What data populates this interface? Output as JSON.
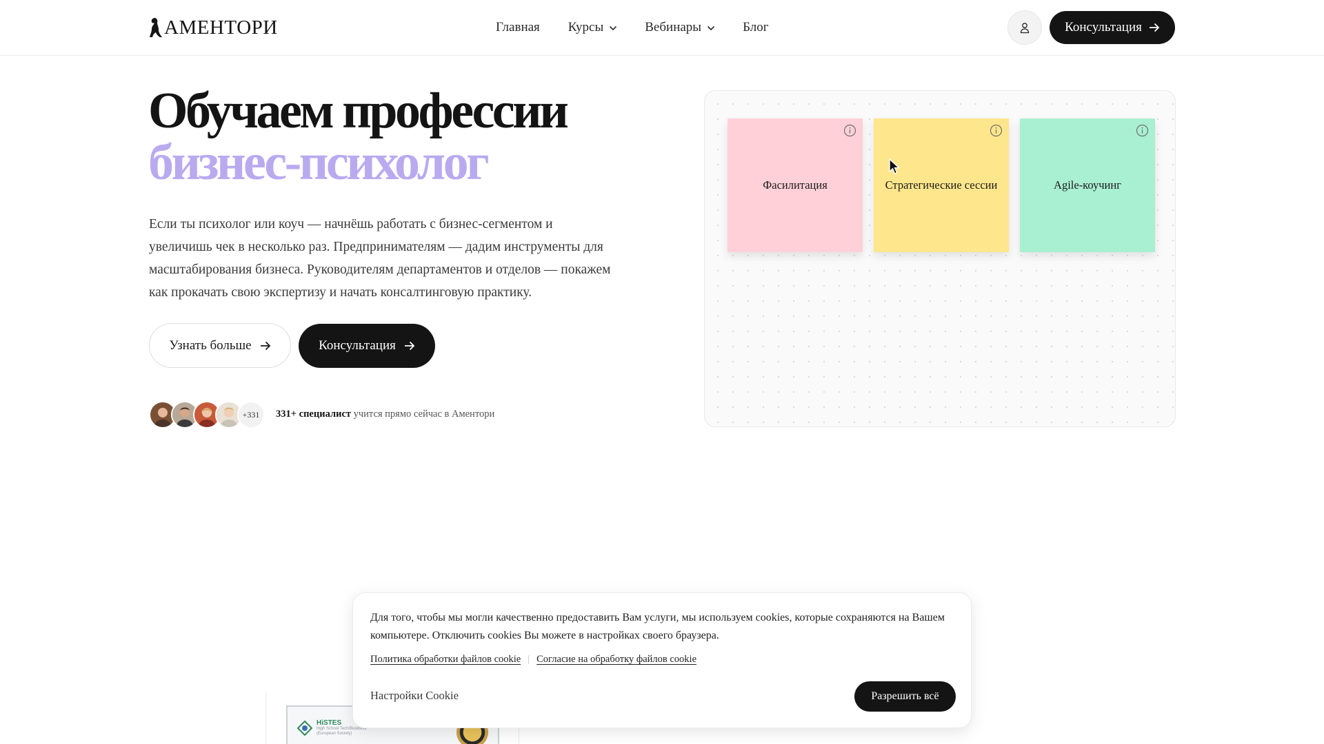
{
  "header": {
    "logo_text": "АМЕНТОРИ",
    "nav": [
      {
        "label": "Главная",
        "has_dropdown": false
      },
      {
        "label": "Курсы",
        "has_dropdown": true
      },
      {
        "label": "Вебинары",
        "has_dropdown": true
      },
      {
        "label": "Блог",
        "has_dropdown": false
      }
    ],
    "user_icon": "user-icon",
    "cta_label": "Консультация"
  },
  "hero": {
    "title_line1": "Обучаем профессии",
    "title_line2": "бизнес-психолог",
    "accent_color": "#b9aaf0",
    "lead": "Если ты психолог или коуч — начнёшь работать с бизнес-сегментом и увеличишь чек в несколько раз. Предпринимателям — дадим инструменты для масштабирования бизнеса. Руководителям департаментов и отделов — покажем как прокачать свою экспертизу и начать консалтинговую практику.",
    "btn_more": "Узнать больше",
    "btn_consult": "Консультация",
    "avatars_count_label": "+331",
    "social_bold": "331+ специалист",
    "social_rest": " учится прямо сейчас в Аментори"
  },
  "board": {
    "cards": [
      {
        "label": "Фасилитация",
        "color": "#ffd0d8"
      },
      {
        "label": "Стратегические сессии",
        "color": "#fde68b"
      },
      {
        "label": "Agile-коучинг",
        "color": "#a9efd2"
      }
    ]
  },
  "certificate": {
    "org": "HiSTES",
    "org_sub1": "High School Tech/Business",
    "org_sub2": "(European Society)"
  },
  "cookie": {
    "text": "Для того, чтобы мы могли качественно предоставить Вам услуги, мы используем cookies, которые сохраняются на Вашем компьютере. Отключить cookies Вы можете в настройках своего браузера.",
    "link1": "Политика обработки файлов cookie",
    "link2": "Согласие на обработку файлов cookie",
    "settings_label": "Настройки Cookie",
    "allow_label": "Разрешить всё"
  }
}
